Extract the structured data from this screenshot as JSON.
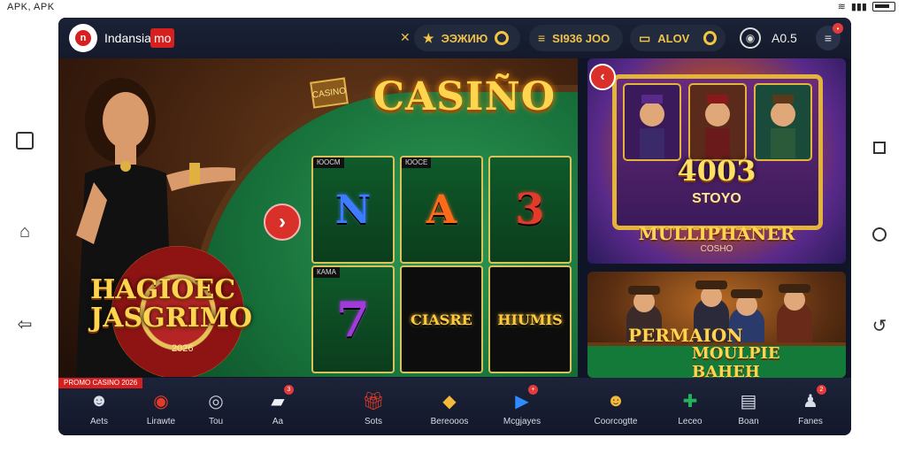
{
  "status_bar": {
    "left_text": "APK, APK"
  },
  "header": {
    "brand": "Indansia",
    "brand_badge": "mo",
    "balance_1": "ЭЭЖИЮ",
    "balance_2": "SI936 JOO",
    "balance_3": "ALOV",
    "level_value": "A0.5"
  },
  "banner": {
    "title": "CASIÑO",
    "plate_label": "CASINO",
    "promo_line_1": "HAGIOEC",
    "promo_line_2": "JASGRIMO",
    "promo_year": "2026",
    "slots": [
      {
        "tag": "ЮОСМ",
        "symbol": "N",
        "color": "#3d7bff"
      },
      {
        "tag": "ЮОСЕ",
        "symbol": "A",
        "color": "#ff6a1a"
      },
      {
        "tag": "",
        "symbol": "3",
        "color": "#e23b2a"
      },
      {
        "tag": "КАМА",
        "symbol": "7",
        "color": "#a03ad8"
      },
      {
        "tag": "",
        "symbol": "CIASRE",
        "color": "#ffc93c"
      },
      {
        "tag": "",
        "symbol": "HIUMIS",
        "color": "#ffc93c"
      }
    ]
  },
  "cards": {
    "card1_big": "4003",
    "card1_sub": "STOYO",
    "card1_title": "MULLIPHANER",
    "card1_subtitle": "COSHO",
    "card2_line_1": "PERMAION",
    "card2_line_2": "MOULPIE BAHEH"
  },
  "bottom_bar": {
    "promo_strip": "PROMO CASINO 2026",
    "items": [
      {
        "label": "Aets",
        "icon": "user-icon",
        "glyph": "☻",
        "color": "#d9dde8",
        "badge": ""
      },
      {
        "label": "Lirawte",
        "icon": "roulette-icon",
        "glyph": "◉",
        "color": "#e23b2a",
        "badge": ""
      },
      {
        "label": "Tou",
        "icon": "chip-icon",
        "glyph": "◎",
        "color": "#c9ccd6",
        "badge": ""
      },
      {
        "label": "Aa",
        "icon": "cards-icon",
        "glyph": "▰",
        "color": "#eef0f6",
        "badge": "3"
      },
      {
        "label": "Sots",
        "icon": "gift-icon",
        "glyph": "🎁︎",
        "color": "#e23b2a",
        "badge": ""
      },
      {
        "label": "Bereooos",
        "icon": "treasure-icon",
        "glyph": "◆",
        "color": "#f2b93a",
        "badge": ""
      },
      {
        "label": "Mcgjayes",
        "icon": "play-icon",
        "glyph": "▶",
        "color": "#2d8cff",
        "badge": "+"
      },
      {
        "label": "Coorcogtte",
        "icon": "trophy-icon",
        "glyph": "☻",
        "color": "#f2b93a",
        "badge": ""
      },
      {
        "label": "Leceo",
        "icon": "medal-icon",
        "glyph": "✚",
        "color": "#23b45a",
        "badge": ""
      },
      {
        "label": "Boan",
        "icon": "ticket-icon",
        "glyph": "▤",
        "color": "#d9dde8",
        "badge": ""
      },
      {
        "label": "Fanes",
        "icon": "person-icon",
        "glyph": "♟",
        "color": "#d9dde8",
        "badge": "2"
      }
    ]
  }
}
